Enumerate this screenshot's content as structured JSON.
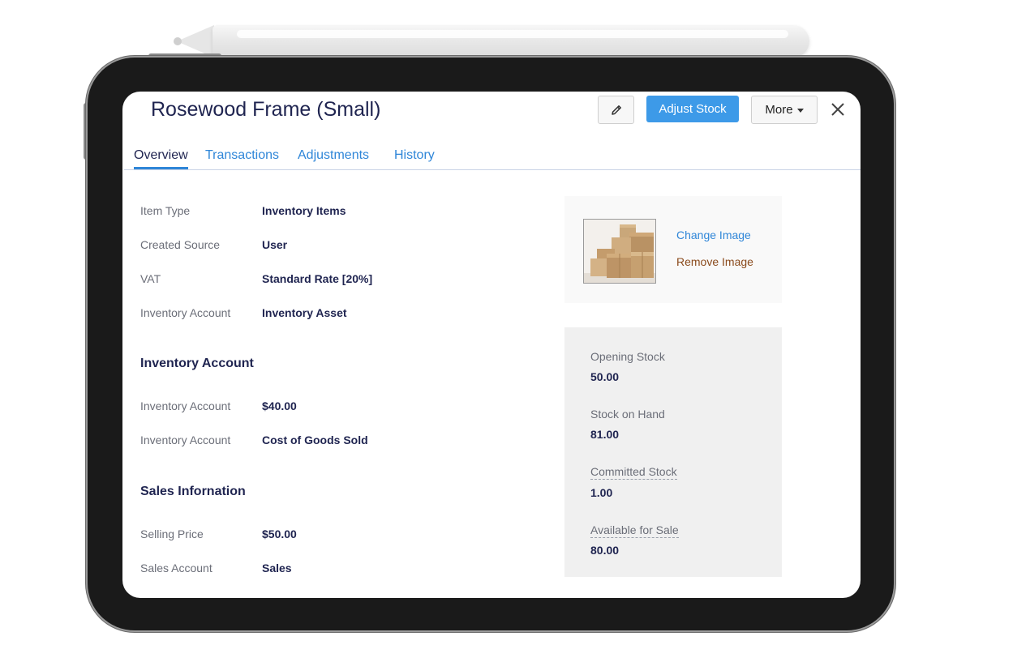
{
  "header": {
    "title": "Rosewood Frame (Small)",
    "edit_icon": "pencil-icon",
    "adjust_stock_label": "Adjust Stock",
    "more_label": "More",
    "close_icon": "close-icon"
  },
  "tabs": [
    {
      "label": "Overview",
      "active": true
    },
    {
      "label": "Transactions",
      "active": false
    },
    {
      "label": "Adjustments",
      "active": false
    },
    {
      "label": "History",
      "active": false
    }
  ],
  "details": [
    {
      "label": "Item Type",
      "value": "Inventory Items"
    },
    {
      "label": "Created Source",
      "value": "User"
    },
    {
      "label": "VAT",
      "value": "Standard Rate [20%]"
    },
    {
      "label": "Inventory Account",
      "value": "Inventory Asset"
    }
  ],
  "inventory_section": {
    "heading": "Inventory Account",
    "rows": [
      {
        "label": "Inventory Account",
        "value": "$40.00"
      },
      {
        "label": "Inventory Account",
        "value": "Cost of Goods Sold"
      }
    ]
  },
  "sales_section": {
    "heading": "Sales Infornation",
    "rows": [
      {
        "label": "Selling Price",
        "value": "$50.00"
      },
      {
        "label": "Sales Account",
        "value": "Sales"
      }
    ]
  },
  "image_panel": {
    "change_label": "Change Image",
    "remove_label": "Remove Image"
  },
  "stock": [
    {
      "label": "Opening Stock",
      "value": "50.00"
    },
    {
      "label": "Stock on Hand",
      "value": "81.00"
    },
    {
      "label": "Committed Stock",
      "value": "1.00"
    },
    {
      "label": "Available for Sale",
      "value": "80.00"
    }
  ],
  "colors": {
    "accent": "#3d9ae8",
    "link": "#2f86d8",
    "remove_link": "#8a4a1c",
    "heading": "#1f2450"
  }
}
